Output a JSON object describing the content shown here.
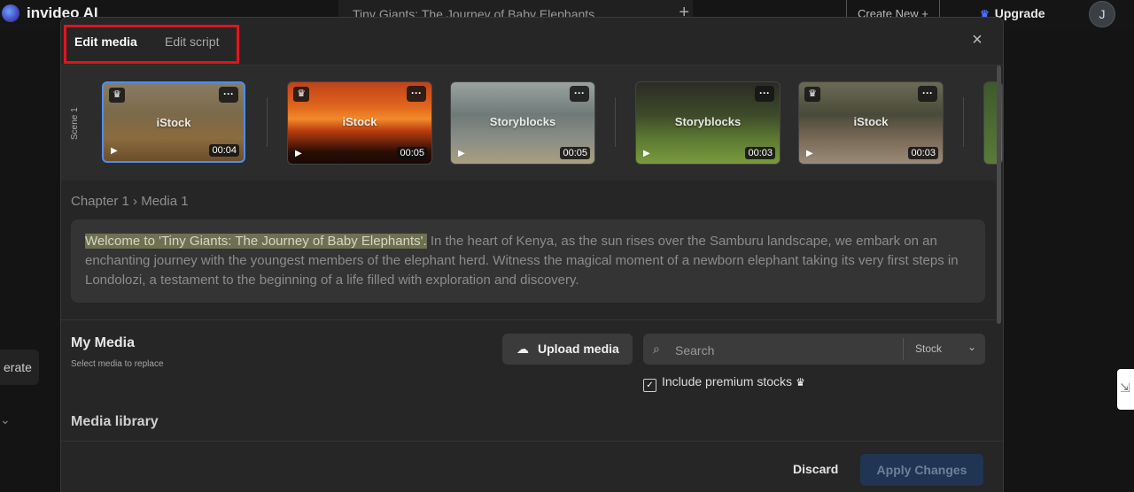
{
  "app": {
    "logo_text": "invideo AI",
    "project_title": "Tiny Giants: The Journey of Baby Elephants",
    "create_new": "Create New +",
    "upgrade": "Upgrade",
    "avatar_initial": "J",
    "side_button": "erate"
  },
  "modal": {
    "tabs": {
      "edit_media": "Edit media",
      "edit_script": "Edit script"
    },
    "close_label": "×",
    "scene_label": "Scene 1",
    "thumbnails": [
      {
        "source": "iStock",
        "duration": "00:04",
        "selected": true
      },
      {
        "source": "iStock",
        "duration": "00:05",
        "selected": false
      },
      {
        "source": "Storyblocks",
        "duration": "00:05",
        "selected": false
      },
      {
        "source": "Storyblocks",
        "duration": "00:03",
        "selected": false
      },
      {
        "source": "iStock",
        "duration": "00:03",
        "selected": false
      }
    ],
    "breadcrumb": "Chapter 1 › Media 1",
    "script": {
      "highlighted": "Welcome to 'Tiny Giants: The Journey of Baby Elephants'.",
      "rest": " In the heart of Kenya, as the sun rises over the Samburu landscape, we embark on an enchanting journey with the youngest members of the elephant herd. Witness the magical moment of a newborn elephant taking its very first steps in Londolozi, a testament to the beginning of a life filled with exploration and discovery."
    },
    "my_media": {
      "title": "My Media",
      "subtitle": "Select media to replace"
    },
    "upload_button": "Upload media",
    "search": {
      "placeholder": "Search",
      "filter": "Stock"
    },
    "premium_checkbox": {
      "label": "Include premium stocks",
      "checked": true
    },
    "media_library": "Media library",
    "footer": {
      "discard": "Discard",
      "apply": "Apply Changes"
    }
  },
  "colors": {
    "accent": "#4b8ef5",
    "highlight_box": "#e0141e",
    "apply_bg": "#1f3553"
  }
}
